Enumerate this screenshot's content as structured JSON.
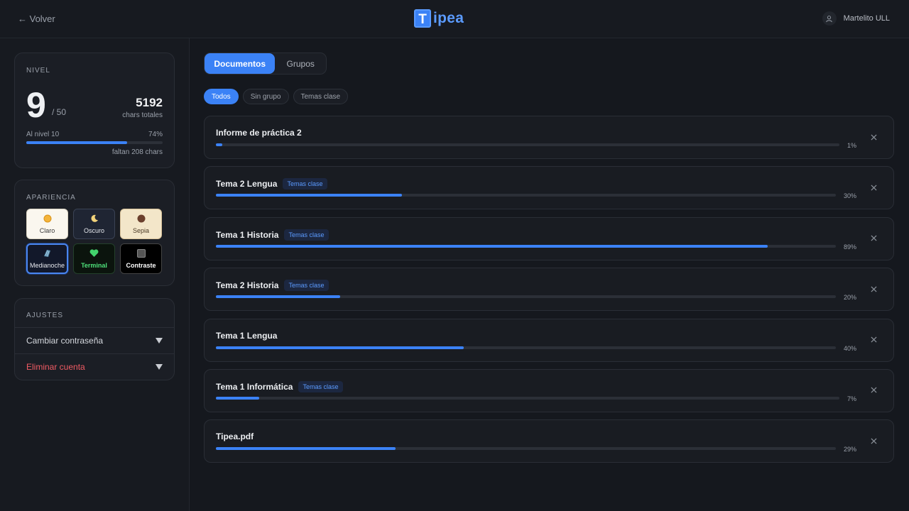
{
  "header": {
    "back_label": "← Volver",
    "logo_letter": "T",
    "logo_text": "ipea",
    "username": "Martelito ULL",
    "user_icon": "user-icon"
  },
  "sidebar": {
    "level": {
      "title": "NIVEL",
      "value": "9",
      "max": "/ 50",
      "chars_total": "5192",
      "chars_label": "chars totales",
      "next_label": "Al nivel 10",
      "next_pct": "74%",
      "progress": 74,
      "remaining": "faltan 208 chars"
    },
    "appearance": {
      "title": "APARIENCIA",
      "themes": [
        {
          "label": "Claro",
          "icon": "☀"
        },
        {
          "label": "Oscuro",
          "icon": "☾"
        },
        {
          "label": "Sepia",
          "icon": "●"
        },
        {
          "label": "Medianoche",
          "icon": "▨"
        },
        {
          "label": "Terminal",
          "icon": "♥"
        },
        {
          "label": "Contraste",
          "icon": "■"
        }
      ],
      "selected": "Medianoche"
    },
    "settings": {
      "title": "AJUSTES",
      "change_password": "Cambiar contraseña",
      "delete_account": "Eliminar cuenta"
    }
  },
  "main": {
    "tabs": [
      {
        "label": "Documentos",
        "active": true
      },
      {
        "label": "Grupos",
        "active": false
      }
    ],
    "filters": [
      {
        "label": "Todos",
        "active": true
      },
      {
        "label": "Sin grupo",
        "active": false
      },
      {
        "label": "Temas clase",
        "active": false
      }
    ],
    "documents": [
      {
        "title": "Informe de práctica 2",
        "tag": "",
        "progress": 1,
        "pct": "1%"
      },
      {
        "title": "Tema 2 Lengua",
        "tag": "Temas clase",
        "progress": 30,
        "pct": "30%"
      },
      {
        "title": "Tema 1 Historia",
        "tag": "Temas clase",
        "progress": 89,
        "pct": "89%"
      },
      {
        "title": "Tema 2 Historia",
        "tag": "Temas clase",
        "progress": 20,
        "pct": "20%"
      },
      {
        "title": "Tema 1 Lengua",
        "tag": "",
        "progress": 40,
        "pct": "40%"
      },
      {
        "title": "Tema 1 Informática",
        "tag": "Temas clase",
        "progress": 7,
        "pct": "7%"
      },
      {
        "title": "Tipea.pdf",
        "tag": "",
        "progress": 29,
        "pct": "29%"
      }
    ]
  },
  "colors": {
    "accent": "#3b82f6",
    "danger": "#f05b63",
    "background": "#15181e"
  }
}
